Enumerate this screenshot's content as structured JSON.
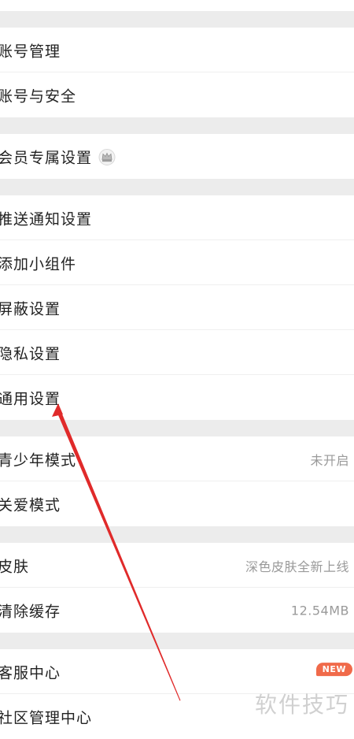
{
  "settings": {
    "account_management": "账号管理",
    "account_security": "账号与安全",
    "vip_settings": "会员专属设置",
    "push_notifications": "推送通知设置",
    "add_widget": "添加小组件",
    "block_settings": "屏蔽设置",
    "privacy_settings": "隐私设置",
    "general_settings": "通用设置",
    "teen_mode": "青少年模式",
    "teen_mode_value": "未开启",
    "care_mode": "关爱模式",
    "skin": "皮肤",
    "skin_value": "深色皮肤全新上线",
    "clear_cache": "清除缓存",
    "clear_cache_value": "12.54MB",
    "customer_service": "客服中心",
    "customer_service_badge": "NEW",
    "community_management": "社区管理中心"
  },
  "watermark": "软件技巧",
  "colors": {
    "annotation_arrow": "#e02a2a",
    "badge": "#f06a4a",
    "section_gap": "#ececec"
  },
  "icons": {
    "vip": "crown-icon"
  }
}
